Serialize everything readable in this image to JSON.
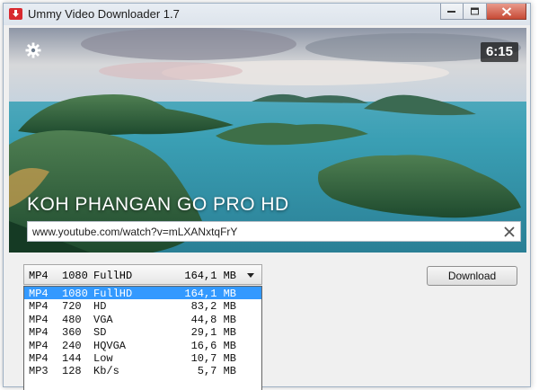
{
  "window": {
    "title": "Ummy Video Downloader 1.7",
    "app_icon": "download-arrow-icon",
    "controls": [
      "minimize-icon",
      "maximize-icon",
      "close-icon"
    ]
  },
  "video": {
    "settings_icon": "gear-icon",
    "duration": "6:15",
    "title": "KOH PHANGAN GO PRO HD",
    "url": "www.youtube.com/watch?v=mLXANxtqFrY",
    "clear_icon": "close-icon"
  },
  "format": {
    "selected": {
      "container": "MP4",
      "resolution": "1080",
      "quality": "FullHD",
      "size": "164,1 MB"
    },
    "options": [
      {
        "container": "MP4",
        "resolution": "1080",
        "quality": "FullHD",
        "size": "164,1 MB"
      },
      {
        "container": "MP4",
        "resolution": "720",
        "quality": "HD",
        "size": "83,2 MB"
      },
      {
        "container": "MP4",
        "resolution": "480",
        "quality": "VGA",
        "size": "44,8 MB"
      },
      {
        "container": "MP4",
        "resolution": "360",
        "quality": "SD",
        "size": "29,1 MB"
      },
      {
        "container": "MP4",
        "resolution": "240",
        "quality": "HQVGA",
        "size": "16,6 MB"
      },
      {
        "container": "MP4",
        "resolution": "144",
        "quality": "Low",
        "size": "10,7 MB"
      },
      {
        "container": "MP3",
        "resolution": "128",
        "quality": "Kb/s",
        "size": "5,7 MB"
      }
    ],
    "highlight_color": "#3399ff"
  },
  "download_button": {
    "label": "Download"
  }
}
